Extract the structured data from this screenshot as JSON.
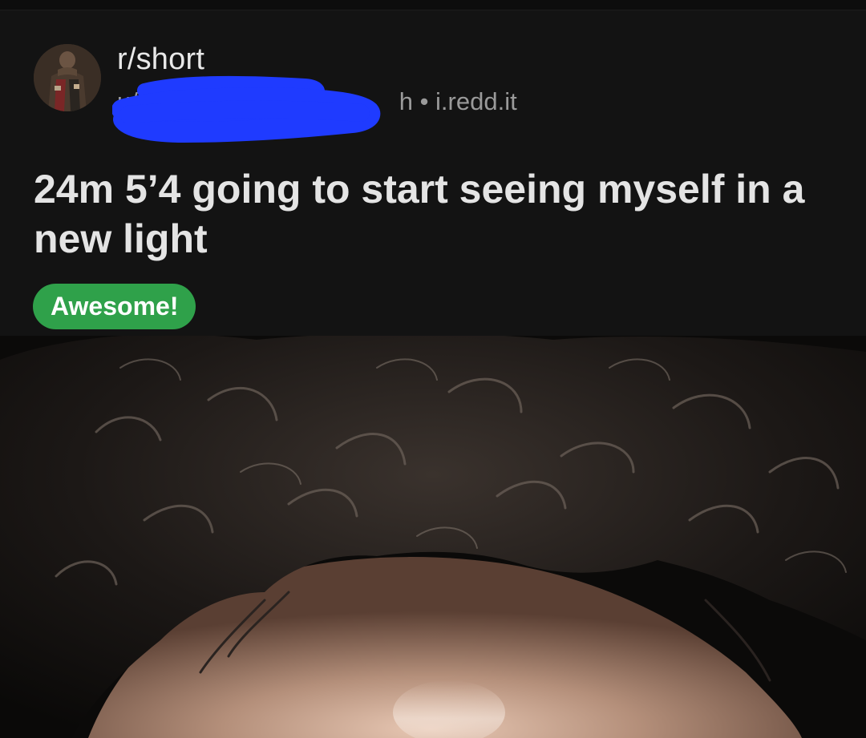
{
  "post": {
    "subreddit": "r/short",
    "author": "u/M",
    "age": "h",
    "separator": "•",
    "domain": "i.redd.it",
    "title": "24m 5’4 going to start seeing myself in a new light",
    "flair": "Awesome!",
    "flair_color": "#2fa14a"
  },
  "avatar": {
    "icon": "subreddit-avatar-icon"
  },
  "image": {
    "icon": "post-image"
  },
  "colors": {
    "background": "#131313",
    "text_primary": "#e4e4e4",
    "text_secondary": "#9a9a9a",
    "redaction": "#1f3bff"
  }
}
